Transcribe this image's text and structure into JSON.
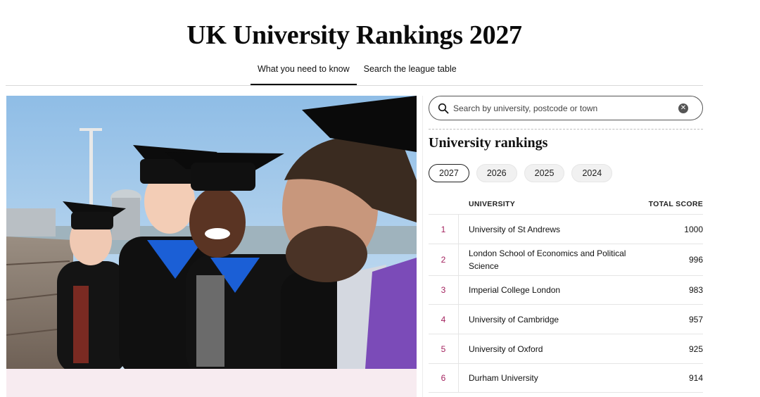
{
  "page": {
    "title": "UK University Rankings 2027"
  },
  "tabs": [
    {
      "label": "What you need to know",
      "active": true
    },
    {
      "label": "Search the league table",
      "active": false
    }
  ],
  "search": {
    "placeholder": "Search by university, postcode or town",
    "value": ""
  },
  "rankings": {
    "heading": "University rankings",
    "years": [
      "2027",
      "2026",
      "2025",
      "2024"
    ],
    "active_year": "2027",
    "columns": {
      "university": "UNIVERSITY",
      "score": "TOTAL SCORE"
    },
    "rows": [
      {
        "rank": "1",
        "university": "University of St Andrews",
        "score": "1000"
      },
      {
        "rank": "2",
        "university": "London School of Economics and Political Science",
        "score": "996"
      },
      {
        "rank": "3",
        "university": "Imperial College London",
        "score": "983"
      },
      {
        "rank": "4",
        "university": "University of Cambridge",
        "score": "957"
      },
      {
        "rank": "5",
        "university": "University of Oxford",
        "score": "925"
      },
      {
        "rank": "6",
        "university": "Durham University",
        "score": "914"
      }
    ]
  },
  "colors": {
    "rank_accent": "#a3225e",
    "panel_pink": "#f7ebf0",
    "academic_hood": "#1b5fd6",
    "hood_purple": "#7b4bb8"
  },
  "icons": {
    "search": "search-icon",
    "clear": "clear-icon"
  }
}
